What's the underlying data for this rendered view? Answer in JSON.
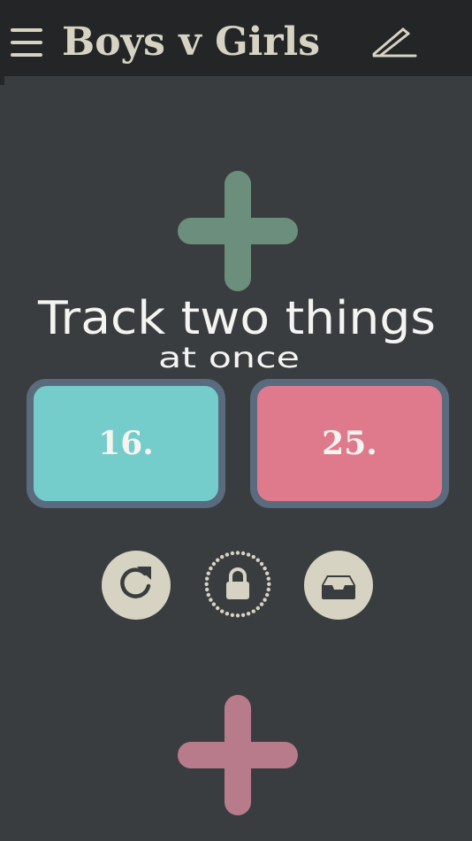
{
  "header": {
    "title": "Boys v Girls",
    "menu_icon": "hamburger-menu-icon",
    "edit_icon": "pencil-icon"
  },
  "main": {
    "headline": "Track two things",
    "subheadline": "at once",
    "counters": [
      {
        "value": "16.",
        "color": "#74cccb"
      },
      {
        "value": "25.",
        "color": "#df7a8c"
      }
    ],
    "increment_icons": [
      "plus-icon",
      "plus-icon"
    ],
    "actions": [
      {
        "icon": "reset-icon"
      },
      {
        "icon": "lock-icon"
      },
      {
        "icon": "inbox-icon"
      }
    ]
  },
  "colors": {
    "background": "#3a3d40",
    "topbar": "#232527",
    "accent_light": "#d6d3c2",
    "plus_top": "#6b8f7c",
    "plus_bottom": "#b87b8c",
    "counter_border": "#5a6b7e"
  }
}
